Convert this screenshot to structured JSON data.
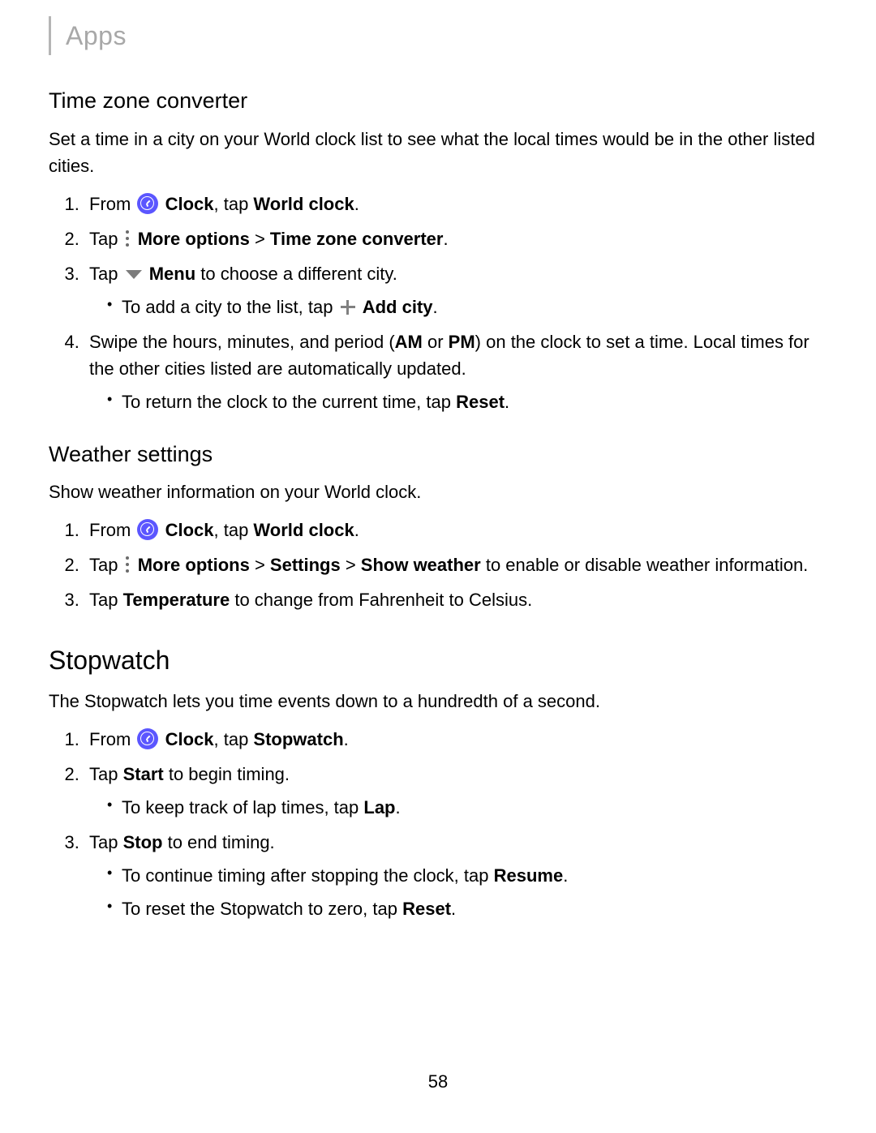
{
  "header": {
    "crumb": "Apps"
  },
  "tzc": {
    "title": "Time zone converter",
    "intro": "Set a time in a city on your World clock list to see what the local times would be in the other listed cities.",
    "s1_text_from": "From",
    "s1_clock_bold": "Clock",
    "s1_tap": ", tap ",
    "s1_world_bold": "World clock",
    "s1_end": ".",
    "s2_tap": "Tap",
    "s2_more_bold": "More options",
    "s2_sep": " > ",
    "s2_tzc_bold": "Time zone converter",
    "s2_end": ".",
    "s3_tap": "Tap",
    "s3_menu_bold": "Menu",
    "s3_rest": " to choose a different city.",
    "s3_sub_pre": "To add a city to the list, tap",
    "s3_sub_add_bold": "Add city",
    "s3_sub_end": ".",
    "s4_pre": "Swipe the hours, minutes, and period (",
    "s4_am": "AM",
    "s4_or": " or ",
    "s4_pm": "PM",
    "s4_post": ") on the clock to set a time. Local times for the other cities listed are automatically updated.",
    "s4_sub_pre": "To return the clock to the current time, tap ",
    "s4_sub_reset": "Reset",
    "s4_sub_end": "."
  },
  "weather": {
    "title": "Weather settings",
    "intro": "Show weather information on your World clock.",
    "s1_from": "From",
    "s1_clock_bold": "Clock",
    "s1_tap": ", tap ",
    "s1_world_bold": "World clock",
    "s1_end": ".",
    "s2_tap": "Tap",
    "s2_more_bold": "More options",
    "s2_sep1": " > ",
    "s2_settings_bold": "Settings",
    "s2_sep2": " > ",
    "s2_show_bold": "Show weather",
    "s2_rest": " to enable or disable weather information.",
    "s3_tap": "Tap ",
    "s3_temp_bold": "Temperature",
    "s3_rest": " to change from Fahrenheit to Celsius."
  },
  "stopwatch": {
    "title": "Stopwatch",
    "intro": "The Stopwatch lets you time events down to a hundredth of a second.",
    "s1_from": "From",
    "s1_clock_bold": "Clock",
    "s1_tap": ", tap ",
    "s1_sw_bold": "Stopwatch",
    "s1_end": ".",
    "s2_tap": "Tap ",
    "s2_start_bold": "Start",
    "s2_rest": " to begin timing.",
    "s2_sub_pre": "To keep track of lap times, tap ",
    "s2_sub_lap": "Lap",
    "s2_sub_end": ".",
    "s3_tap": "Tap ",
    "s3_stop_bold": "Stop",
    "s3_rest": " to end timing.",
    "s3_sub1_pre": "To continue timing after stopping the clock, tap ",
    "s3_sub1_resume": "Resume",
    "s3_sub1_end": ".",
    "s3_sub2_pre": "To reset the Stopwatch to zero, tap ",
    "s3_sub2_reset": "Reset",
    "s3_sub2_end": "."
  },
  "page_number": "58"
}
